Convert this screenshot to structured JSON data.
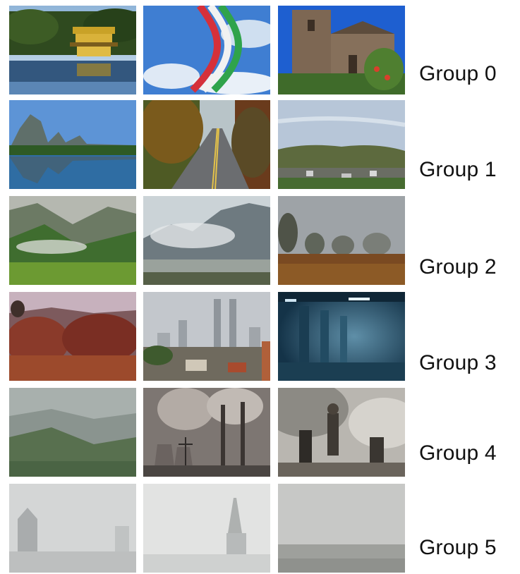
{
  "groups": [
    {
      "label": "Group 0",
      "scenes": [
        "golden-pavilion",
        "colored-smoke-sky",
        "stone-church"
      ]
    },
    {
      "label": "Group 1",
      "scenes": [
        "karst-lake",
        "forest-road",
        "hazy-hills-town"
      ]
    },
    {
      "label": "Group 2",
      "scenes": [
        "green-valley-mist",
        "misty-mountains",
        "foggy-field-trees"
      ]
    },
    {
      "label": "Group 3",
      "scenes": [
        "red-forest-haze",
        "city-towers-haze",
        "blue-tunnel-fog"
      ]
    },
    {
      "label": "Group 4",
      "scenes": [
        "smog-hillside",
        "smokestacks",
        "battle-smoke"
      ]
    },
    {
      "label": "Group 5",
      "scenes": [
        "dense-fog-tower",
        "dense-fog-spire",
        "dense-fog-plain"
      ]
    }
  ]
}
